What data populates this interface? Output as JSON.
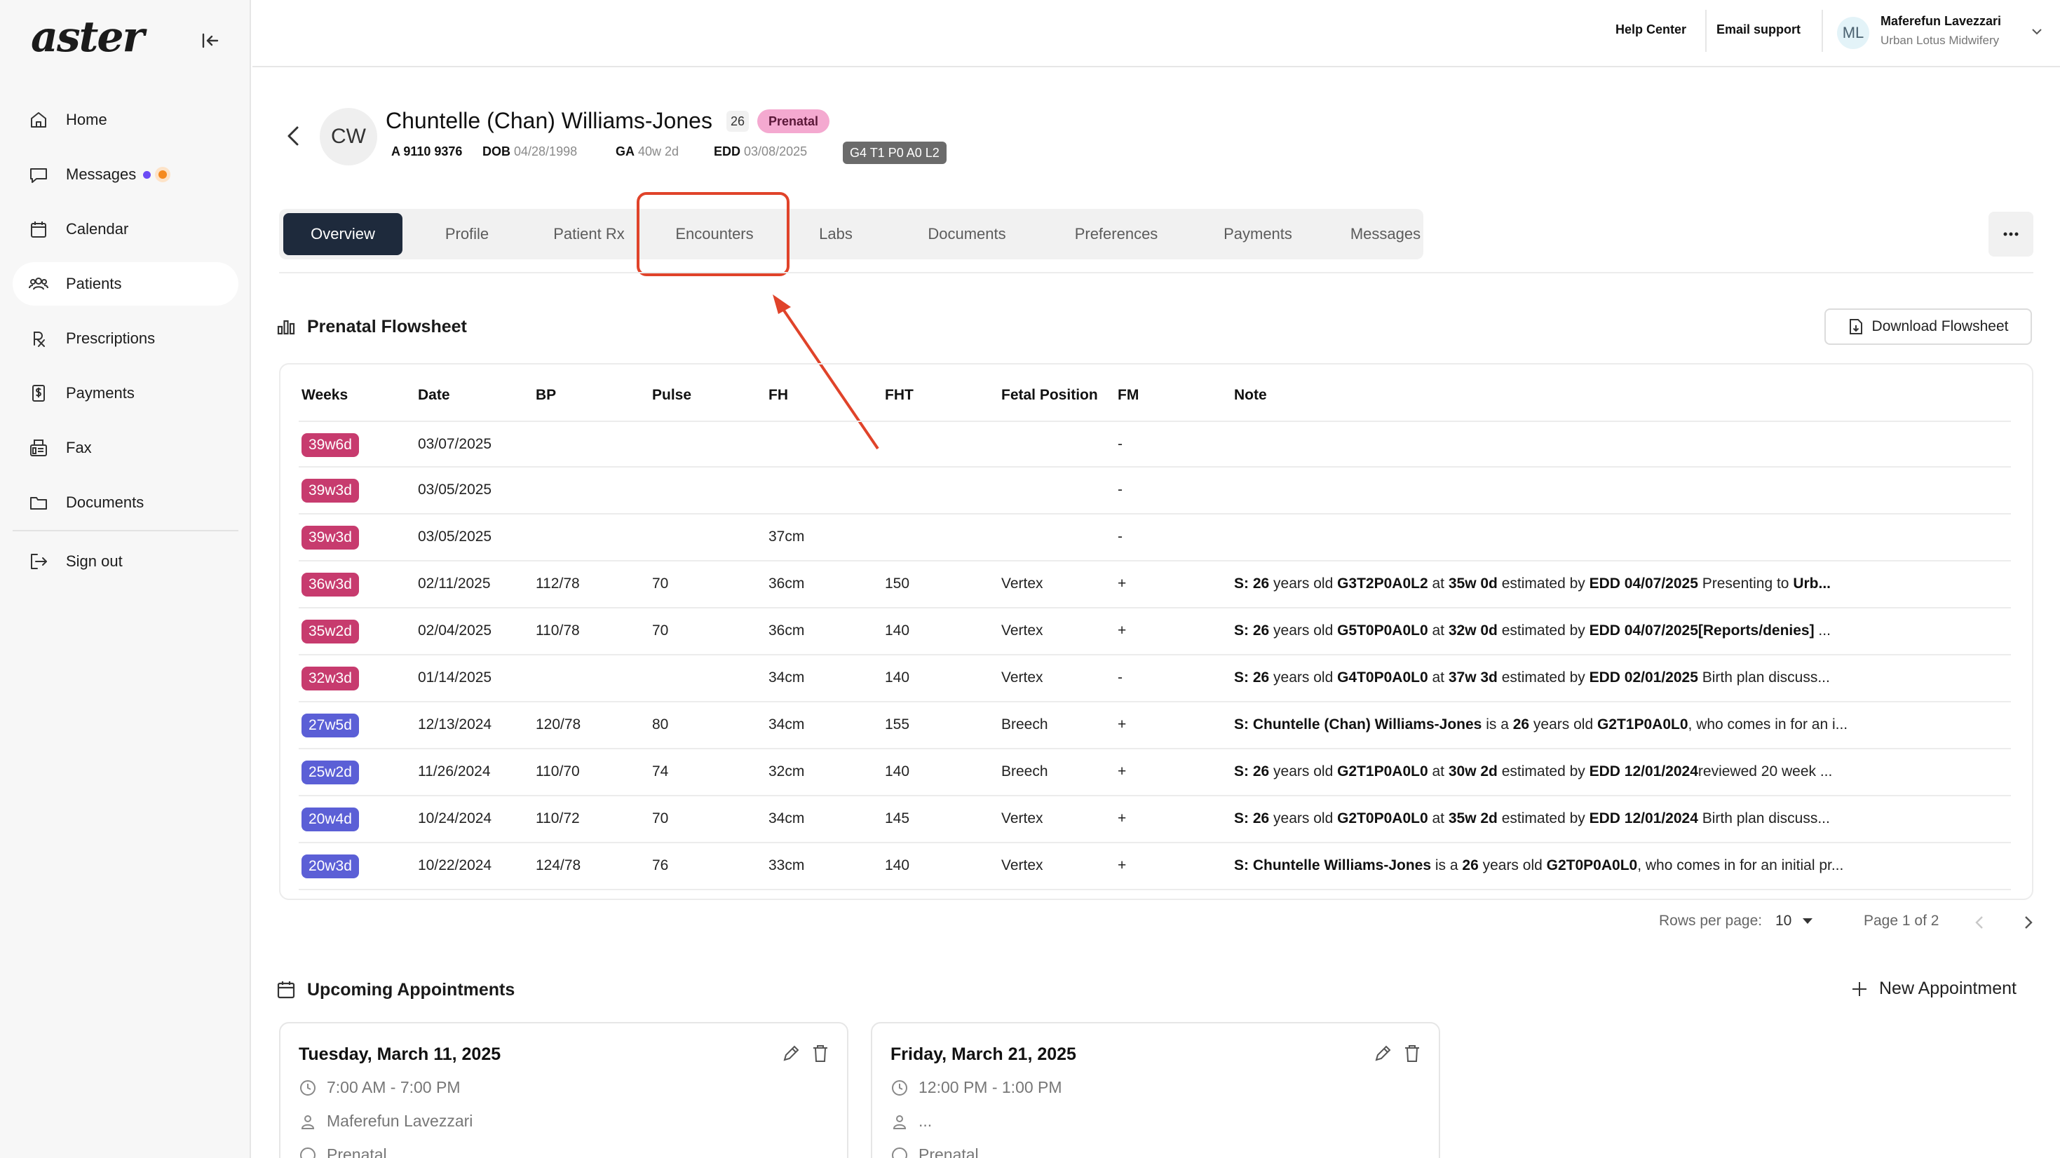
{
  "sidebar": {
    "logo": "aster",
    "items": [
      {
        "label": "Home",
        "icon": "home-icon"
      },
      {
        "label": "Messages",
        "icon": "message-icon"
      },
      {
        "label": "Calendar",
        "icon": "calendar-icon"
      },
      {
        "label": "Patients",
        "icon": "patients-icon"
      },
      {
        "label": "Prescriptions",
        "icon": "rx-icon"
      },
      {
        "label": "Payments",
        "icon": "payments-icon"
      },
      {
        "label": "Fax",
        "icon": "fax-icon"
      },
      {
        "label": "Documents",
        "icon": "folder-icon"
      },
      {
        "label": "Sign out",
        "icon": "sign-out-icon"
      }
    ],
    "active": "Patients",
    "message_dot_colors": [
      "#6c4cf5",
      "#f58a1f"
    ]
  },
  "topbar": {
    "help": "Help Center",
    "email": "Email support",
    "user_initials": "ML",
    "user_name": "Maferefun Lavezzari",
    "user_org": "Urban Lotus Midwifery"
  },
  "patient": {
    "initials": "CW",
    "name": "Chuntelle (Chan) Williams-Jones",
    "age": "26",
    "status": "Prenatal",
    "id": "A 9110 9376",
    "dob_label": "DOB",
    "dob": "04/28/1998",
    "ga_label": "GA",
    "ga": "40w 2d",
    "edd_label": "EDD",
    "edd": "03/08/2025",
    "gtpal": "G4 T1 P0 A0 L2"
  },
  "tabs": [
    "Overview",
    "Profile",
    "Patient Rx",
    "Encounters",
    "Labs",
    "Documents",
    "Preferences",
    "Payments",
    "Messages"
  ],
  "active_tab": "Overview",
  "flowsheet": {
    "title": "Prenatal Flowsheet",
    "download": "Download Flowsheet",
    "headers": [
      "Weeks",
      "Date",
      "BP",
      "Pulse",
      "FH",
      "FHT",
      "Fetal Position",
      "FM",
      "Note"
    ],
    "rows": [
      {
        "weeks": "39w6d",
        "color": "#c73b6e",
        "date": "03/07/2025",
        "bp": "",
        "pulse": "",
        "fh": "",
        "fht": "",
        "pos": "",
        "fm": "-",
        "note": []
      },
      {
        "weeks": "39w3d",
        "color": "#c73b6e",
        "date": "03/05/2025",
        "bp": "",
        "pulse": "",
        "fh": "",
        "fht": "",
        "pos": "",
        "fm": "-",
        "note": []
      },
      {
        "weeks": "39w3d",
        "color": "#c73b6e",
        "date": "03/05/2025",
        "bp": "",
        "pulse": "",
        "fh": "37cm",
        "fht": "",
        "pos": "",
        "fm": "-",
        "note": []
      },
      {
        "weeks": "36w3d",
        "color": "#c73b6e",
        "date": "02/11/2025",
        "bp": "112/78",
        "pulse": "70",
        "fh": "36cm",
        "fht": "150",
        "pos": "Vertex",
        "fm": "+",
        "note": [
          [
            "b",
            "S: 26"
          ],
          [
            "t",
            " years old "
          ],
          [
            "b",
            "G3T2P0A0L2"
          ],
          [
            "t",
            " at "
          ],
          [
            "b",
            "35w 0d"
          ],
          [
            "t",
            " estimated by "
          ],
          [
            "b",
            "EDD 04/07/2025"
          ],
          [
            "t",
            " Presenting to "
          ],
          [
            "b",
            "Urb..."
          ]
        ]
      },
      {
        "weeks": "35w2d",
        "color": "#c73b6e",
        "date": "02/04/2025",
        "bp": "110/78",
        "pulse": "70",
        "fh": "36cm",
        "fht": "140",
        "pos": "Vertex",
        "fm": "+",
        "note": [
          [
            "b",
            "S: 26"
          ],
          [
            "t",
            " years old "
          ],
          [
            "b",
            "G5T0P0A0L0"
          ],
          [
            "t",
            " at "
          ],
          [
            "b",
            "32w 0d"
          ],
          [
            "t",
            " estimated by "
          ],
          [
            "b",
            "EDD 04/07/2025[Reports/denies]"
          ],
          [
            "t",
            " ..."
          ]
        ]
      },
      {
        "weeks": "32w3d",
        "color": "#c73b6e",
        "date": "01/14/2025",
        "bp": "",
        "pulse": "",
        "fh": "34cm",
        "fht": "140",
        "pos": "Vertex",
        "fm": "-",
        "note": [
          [
            "b",
            "S: 26"
          ],
          [
            "t",
            " years old "
          ],
          [
            "b",
            "G4T0P0A0L0"
          ],
          [
            "t",
            " at "
          ],
          [
            "b",
            "37w 3d"
          ],
          [
            "t",
            " estimated by "
          ],
          [
            "b",
            "EDD 02/01/2025"
          ],
          [
            "t",
            " Birth plan discuss..."
          ]
        ]
      },
      {
        "weeks": "27w5d",
        "color": "#5b5fd6",
        "date": "12/13/2024",
        "bp": "120/78",
        "pulse": "80",
        "fh": "34cm",
        "fht": "155",
        "pos": "Breech",
        "fm": "+",
        "note": [
          [
            "b",
            "S: Chuntelle (Chan) Williams-Jones"
          ],
          [
            "t",
            " is a "
          ],
          [
            "b",
            "26"
          ],
          [
            "t",
            " years old "
          ],
          [
            "b",
            "G2T1P0A0L0"
          ],
          [
            "t",
            ", who comes in for an i..."
          ]
        ]
      },
      {
        "weeks": "25w2d",
        "color": "#5b5fd6",
        "date": "11/26/2024",
        "bp": "110/70",
        "pulse": "74",
        "fh": "32cm",
        "fht": "140",
        "pos": "Breech",
        "fm": "+",
        "note": [
          [
            "b",
            "S: 26"
          ],
          [
            "t",
            " years old "
          ],
          [
            "b",
            "G2T1P0A0L0"
          ],
          [
            "t",
            " at "
          ],
          [
            "b",
            "30w 2d"
          ],
          [
            "t",
            " estimated by "
          ],
          [
            "b",
            "EDD 12/01/2024"
          ],
          [
            "t",
            "reviewed 20 week ..."
          ]
        ]
      },
      {
        "weeks": "20w4d",
        "color": "#5b5fd6",
        "date": "10/24/2024",
        "bp": "110/72",
        "pulse": "70",
        "fh": "34cm",
        "fht": "145",
        "pos": "Vertex",
        "fm": "+",
        "note": [
          [
            "b",
            "S: 26"
          ],
          [
            "t",
            " years old "
          ],
          [
            "b",
            "G2T0P0A0L0"
          ],
          [
            "t",
            " at "
          ],
          [
            "b",
            "35w 2d"
          ],
          [
            "t",
            " estimated by "
          ],
          [
            "b",
            "EDD 12/01/2024"
          ],
          [
            "t",
            " Birth plan discuss..."
          ]
        ]
      },
      {
        "weeks": "20w3d",
        "color": "#5b5fd6",
        "date": "10/22/2024",
        "bp": "124/78",
        "pulse": "76",
        "fh": "33cm",
        "fht": "140",
        "pos": "Vertex",
        "fm": "+",
        "note": [
          [
            "b",
            "S: Chuntelle Williams-Jones"
          ],
          [
            "t",
            " is a "
          ],
          [
            "b",
            "26"
          ],
          [
            "t",
            " years old "
          ],
          [
            "b",
            "G2T0P0A0L0"
          ],
          [
            "t",
            ", who comes in for an initial pr..."
          ]
        ]
      }
    ],
    "rows_per_page_label": "Rows per page:",
    "rows_per_page": "10",
    "page": "Page 1 of 2"
  },
  "appointments": {
    "title": "Upcoming Appointments",
    "new_label": "New Appointment",
    "cards": [
      {
        "date": "Tuesday, March 11, 2025",
        "time": "7:00 AM - 7:00 PM",
        "provider": "Maferefun Lavezzari",
        "type": "Prenatal"
      },
      {
        "date": "Friday, March 21, 2025",
        "time": "12:00 PM - 1:00 PM",
        "provider": "...",
        "type": "Prenatal"
      }
    ]
  },
  "annotation": {
    "color": "#e0432a"
  }
}
